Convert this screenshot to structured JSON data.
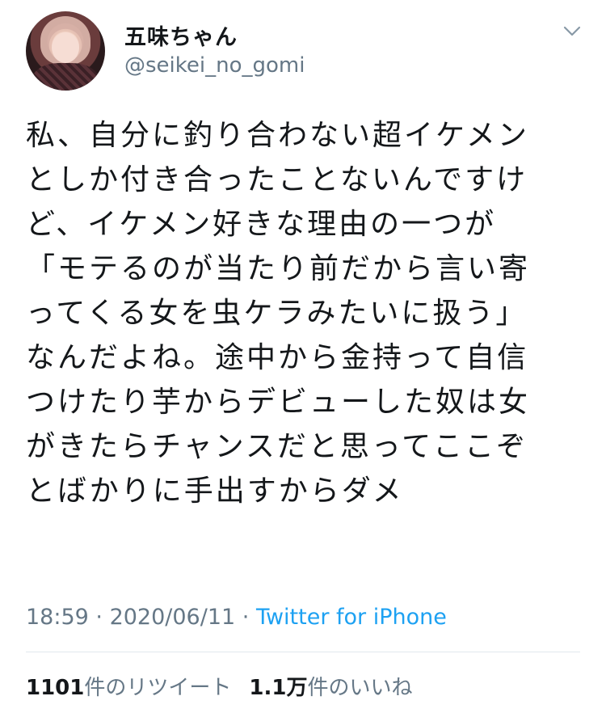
{
  "author": {
    "display_name": "五味ちゃん",
    "handle": "@seikei_no_gomi"
  },
  "tweet": {
    "lines": [
      "私、自分に釣り合わない超イケメン",
      "としか付き合ったことないんですけ",
      "ど、イケメン好きな理由の一つが",
      "「モテるのが当たり前だから言い寄",
      "ってくる女を虫ケラみたいに扱う」",
      "なんだよね。途中から金持って自信",
      "つけたり芋からデビューした奴は女",
      "がきたらチャンスだと思ってここぞ",
      "とばかりに手出すからダメ"
    ]
  },
  "meta": {
    "time": "18:59",
    "sep1": " · ",
    "date": "2020/06/11",
    "sep2": " · ",
    "source": "Twitter for iPhone"
  },
  "stats": {
    "retweets_count": "1101",
    "retweets_label": "件のリツイート",
    "likes_count": "1.1万",
    "likes_label": "件のいいね"
  },
  "icons": {
    "menu": "chevron-down-icon"
  },
  "colors": {
    "text": "#14171a",
    "secondary": "#657786",
    "link": "#1da1f2",
    "divider": "#e1e8ed"
  }
}
